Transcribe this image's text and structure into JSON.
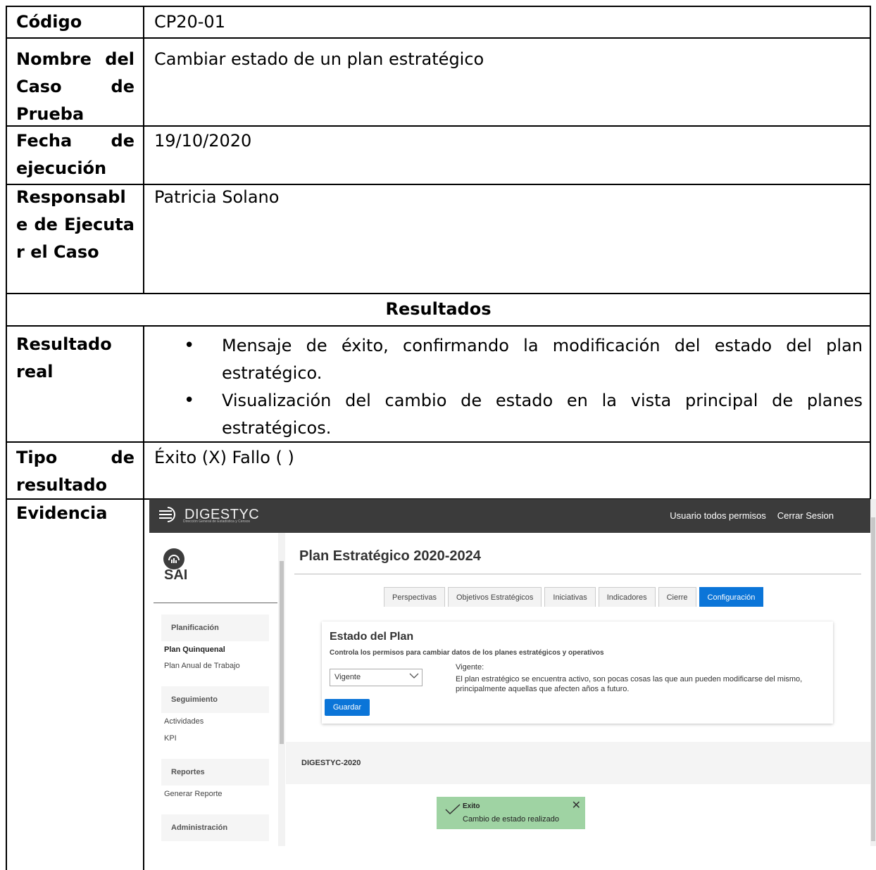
{
  "rows": {
    "codigo": {
      "label": "Código",
      "value": "CP20-01"
    },
    "nombre": {
      "label": "Nombre del Caso de Prueba",
      "value": "Cambiar estado de un plan estratégico"
    },
    "fecha": {
      "label": "Fecha de ejecución",
      "value": "19/10/2020"
    },
    "responsable": {
      "label": "Responsable de Ejecutar el Caso",
      "value": "Patricia Solano"
    },
    "resultados_header": "Resultados",
    "resultado_real": {
      "label": "Resultado real",
      "items": [
        "Mensaje de éxito, confirmando la modificación del estado del plan estratégico.",
        "Visualización del cambio de estado en la vista principal de planes estratégicos."
      ]
    },
    "tipo": {
      "label": "Tipo de resultado",
      "value": "Éxito (X) Fallo ( )"
    },
    "evidencia": {
      "label": "Evidencia"
    }
  },
  "app": {
    "logo_text": "DIGESTYC",
    "logo_sub": "Dirección General de Estadística y Censos",
    "nav": {
      "user": "Usuario todos permisos",
      "logout": "Cerrar Sesion"
    },
    "sidebar": {
      "brand": "SAI",
      "sections": [
        {
          "title": "Planificación",
          "items": [
            "Plan Quinquenal",
            "Plan Anual de Trabajo"
          ]
        },
        {
          "title": "Seguimiento",
          "items": [
            "Actividades",
            "KPI"
          ]
        },
        {
          "title": "Reportes",
          "items": [
            "Generar Reporte"
          ]
        },
        {
          "title": "Administración",
          "items": []
        }
      ]
    },
    "page_title": "Plan Estratégico 2020-2024",
    "tabs": [
      "Perspectivas",
      "Objetivos Estratégicos",
      "Iniciativas",
      "Indicadores",
      "Cierre",
      "Configuración"
    ],
    "active_tab": "Configuración",
    "card": {
      "title": "Estado del Plan",
      "subtitle": "Controla los permisos para cambiar datos de los planes estratégicos y operativos",
      "select_value": "Vigente",
      "state_label": "Vigente:",
      "state_desc": "El plan estratégico se encuentra activo, son pocas cosas las que aun pueden modificarse del mismo, principalmente aquellas que afecten años a futuro.",
      "save": "Guardar"
    },
    "footer": "DIGESTYC-2020",
    "toast": {
      "title": "Exito",
      "message": "Cambio de estado realizado",
      "close": "✕"
    },
    "colors": {
      "topbar": "#3b3b3b",
      "accent": "#0b75d8",
      "toast": "#9fd3a3"
    }
  }
}
